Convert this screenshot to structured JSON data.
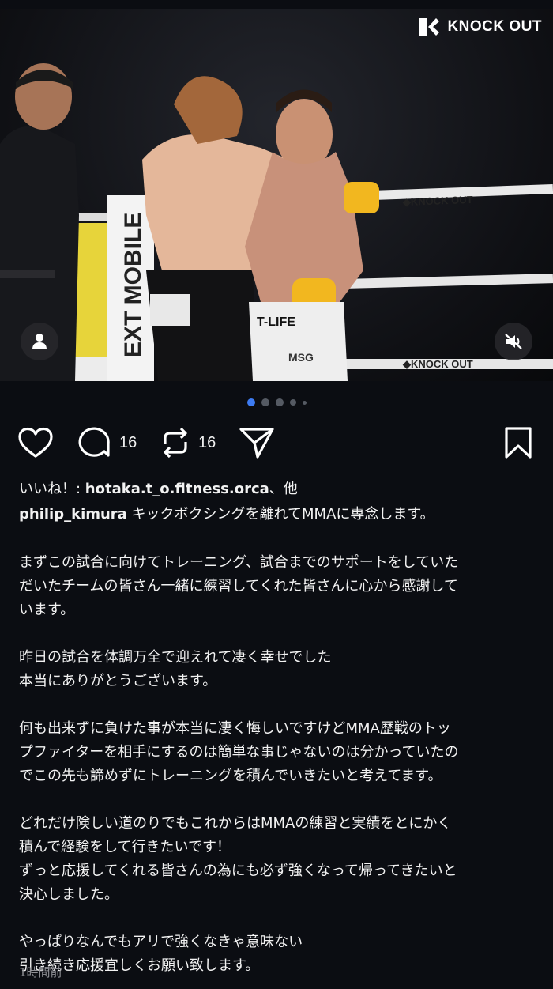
{
  "photo": {
    "watermark": "KNOCK OUT",
    "alt_icons": {
      "user_tag": "person-icon",
      "mute": "speaker-muted-icon"
    }
  },
  "carousel": {
    "count": 5,
    "active_index": 0
  },
  "actions": {
    "comments_count": "16",
    "reposts_count": "16",
    "icons": [
      "heart-icon",
      "comment-icon",
      "repost-icon",
      "send-icon",
      "bookmark-icon"
    ]
  },
  "likes": {
    "prefix": "いいね！: ",
    "user": "hotaka.t_o.fitness.orca",
    "suffix": "、他"
  },
  "caption": {
    "username": "philip_kimura",
    "first_line": " キックボクシングを離れてMMAに専念します。",
    "paragraphs": [
      [
        "まずこの試合に向けてトレーニング、試合までのサポートをしていた",
        "だいたチームの皆さん一緒に練習してくれた皆さんに心から感謝して",
        "います。"
      ],
      [
        "昨日の試合を体調万全で迎えれて凄く幸せでした",
        "本当にありがとうございます。"
      ],
      [
        "何も出来ずに負けた事が本当に凄く悔しいですけどMMA歴戦のトッ",
        "プファイターを相手にするのは簡単な事じゃないのは分かっていたの",
        "でこの先も諦めずにトレーニングを積んでいきたいと考えてます。"
      ],
      [
        "どれだけ険しい道のりでもこれからはMMAの練習と実績をとにかく",
        "積んで経験をして行きたいです！",
        "ずっと応援してくれる皆さんの為にも必ず強くなって帰ってきたいと",
        "決心しました。"
      ],
      [
        "やっぱりなんでもアリで強くなきゃ意味ない",
        "引き続き応援宜しくお願い致します。"
      ]
    ]
  },
  "timestamp": "1時間前",
  "colors": {
    "background": "#0b0d12",
    "accent_dot": "#3d7bf2",
    "muted_text": "#8e8f94"
  }
}
